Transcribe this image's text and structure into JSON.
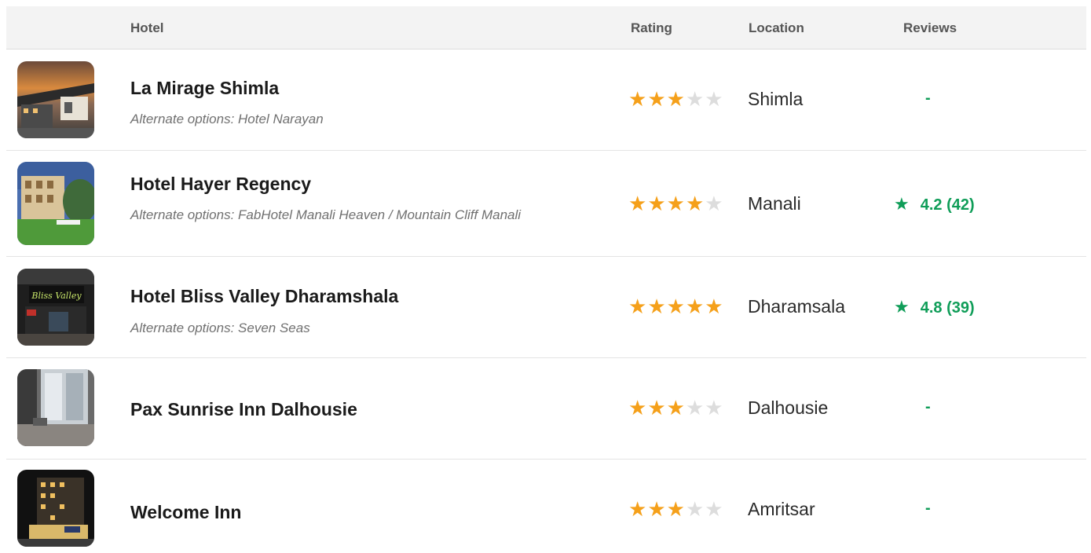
{
  "table": {
    "headers": {
      "hotel": "Hotel",
      "rating": "Rating",
      "location": "Location",
      "reviews": "Reviews"
    },
    "rows": [
      {
        "name": "La Mirage Shimla",
        "alternates": "Alternate options: Hotel Narayan",
        "stars": 3,
        "stars_total": 5,
        "location": "Shimla",
        "reviews": "-",
        "image_icon": "hotel-photo-icon"
      },
      {
        "name": "Hotel Hayer Regency",
        "alternates": "Alternate options: FabHotel Manali Heaven  /  Mountain Cliff Manali",
        "stars": 4,
        "stars_total": 5,
        "location": "Manali",
        "reviews_score": "4.2 (42)",
        "image_icon": "hotel-photo-icon"
      },
      {
        "name": "Hotel Bliss Valley Dharamshala",
        "alternates": "Alternate options: Seven Seas",
        "stars": 5,
        "stars_total": 5,
        "location": "Dharamsala",
        "reviews_score": "4.8 (39)",
        "image_icon": "hotel-photo-icon"
      },
      {
        "name": "Pax Sunrise Inn Dalhousie",
        "stars": 3,
        "stars_total": 5,
        "location": "Dalhousie",
        "reviews": "-",
        "image_icon": "hotel-photo-icon"
      },
      {
        "name": "Welcome Inn",
        "stars": 3,
        "stars_total": 5,
        "location": "Amritsar",
        "reviews": "-",
        "image_icon": "hotel-photo-icon"
      }
    ]
  },
  "colors": {
    "star_filled": "#f5a01a",
    "star_empty": "#dddddd",
    "review_green": "#0f9d58",
    "header_bg": "#f3f3f3"
  }
}
